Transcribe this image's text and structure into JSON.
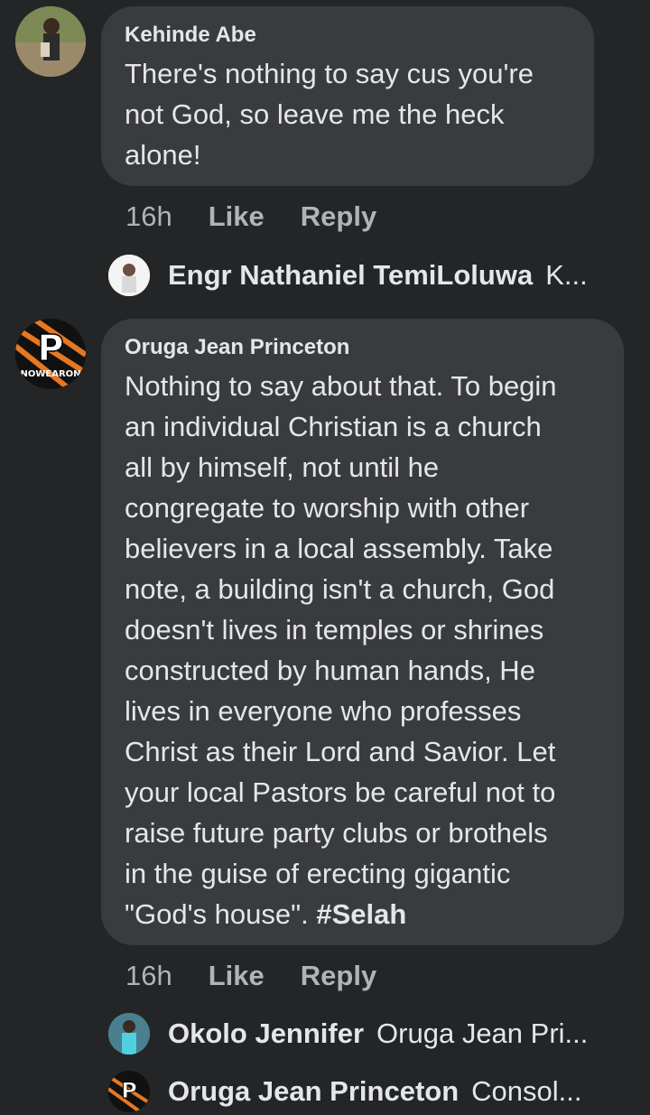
{
  "comments": [
    {
      "author": "Kehinde Abe",
      "text": "There's nothing to say cus you're\nnot God, so leave me the heck\nalone!",
      "time": "16h",
      "like_label": "Like",
      "reply_label": "Reply",
      "replies": [
        {
          "author": "Engr Nathaniel TemiLoluwa",
          "snippet": "K..."
        }
      ]
    },
    {
      "author": "Oruga Jean Princeton",
      "text": "Nothing to say about that. To begin\nan individual Christian is a church\nall by himself, not until he\ncongregate to worship with other\nbelievers in a local assembly. Take\nnote, a building isn't a church, God\ndoesn't lives in temples or shrines\nconstructed by human hands, He\nlives in everyone who professes\nChrist as their Lord and Savior. Let\nyour local Pastors be careful not to\nraise future party clubs or brothels\nin the guise of erecting gigantic\n\"God's house\". ",
      "hashtag": "#Selah",
      "avatar_logo_text": "NOWEARON",
      "time": "16h",
      "like_label": "Like",
      "reply_label": "Reply",
      "replies": [
        {
          "author": "Okolo Jennifer",
          "snippet": "Oruga Jean Pri..."
        },
        {
          "author": "Oruga Jean Princeton",
          "snippet": "Consol..."
        }
      ]
    }
  ],
  "colors": {
    "background": "#242526",
    "bubble": "#3a3b3c",
    "text": "#e4e6eb",
    "meta": "#b0b3b8"
  }
}
